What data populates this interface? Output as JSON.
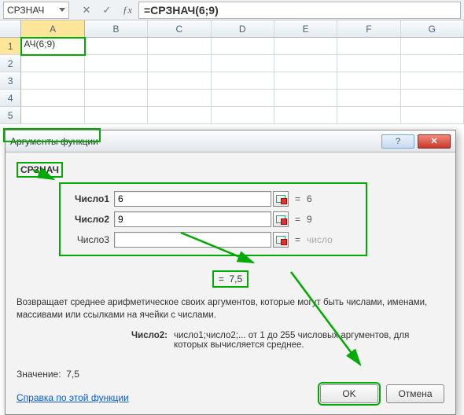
{
  "nameBox": {
    "value": "СРЗНАЧ"
  },
  "formulaBar": {
    "text": "=СРЗНАЧ(6;9)"
  },
  "columns": [
    "A",
    "B",
    "C",
    "D",
    "E",
    "F",
    "G"
  ],
  "rows": [
    "1",
    "2",
    "3",
    "4",
    "5"
  ],
  "activeCell": "АЧ(6;9)",
  "dialog": {
    "title": "Аргументы функции",
    "funcName": "СРЗНАЧ",
    "args": [
      {
        "label": "Число1",
        "value": "6",
        "evaluated": "6",
        "bold": true
      },
      {
        "label": "Число2",
        "value": "9",
        "evaluated": "9",
        "bold": true
      },
      {
        "label": "Число3",
        "value": "",
        "evaluated": "число",
        "bold": false
      }
    ],
    "resultPrefix": "=",
    "result": "7,5",
    "desc1": "Возвращает среднее арифметическое своих аргументов, которые могут быть числами, именами, массивами или ссылками на ячейки с числами.",
    "desc2Label": "Число2:",
    "desc2Text": "число1;число2;... от 1 до 255 числовых аргументов, для которых вычисляется среднее.",
    "valueLabel": "Значение:",
    "valueResult": "7,5",
    "helpLink": "Справка по этой функции",
    "okLabel": "OK",
    "cancelLabel": "Отмена",
    "helpBtn": "?",
    "closeBtn": "✕"
  }
}
